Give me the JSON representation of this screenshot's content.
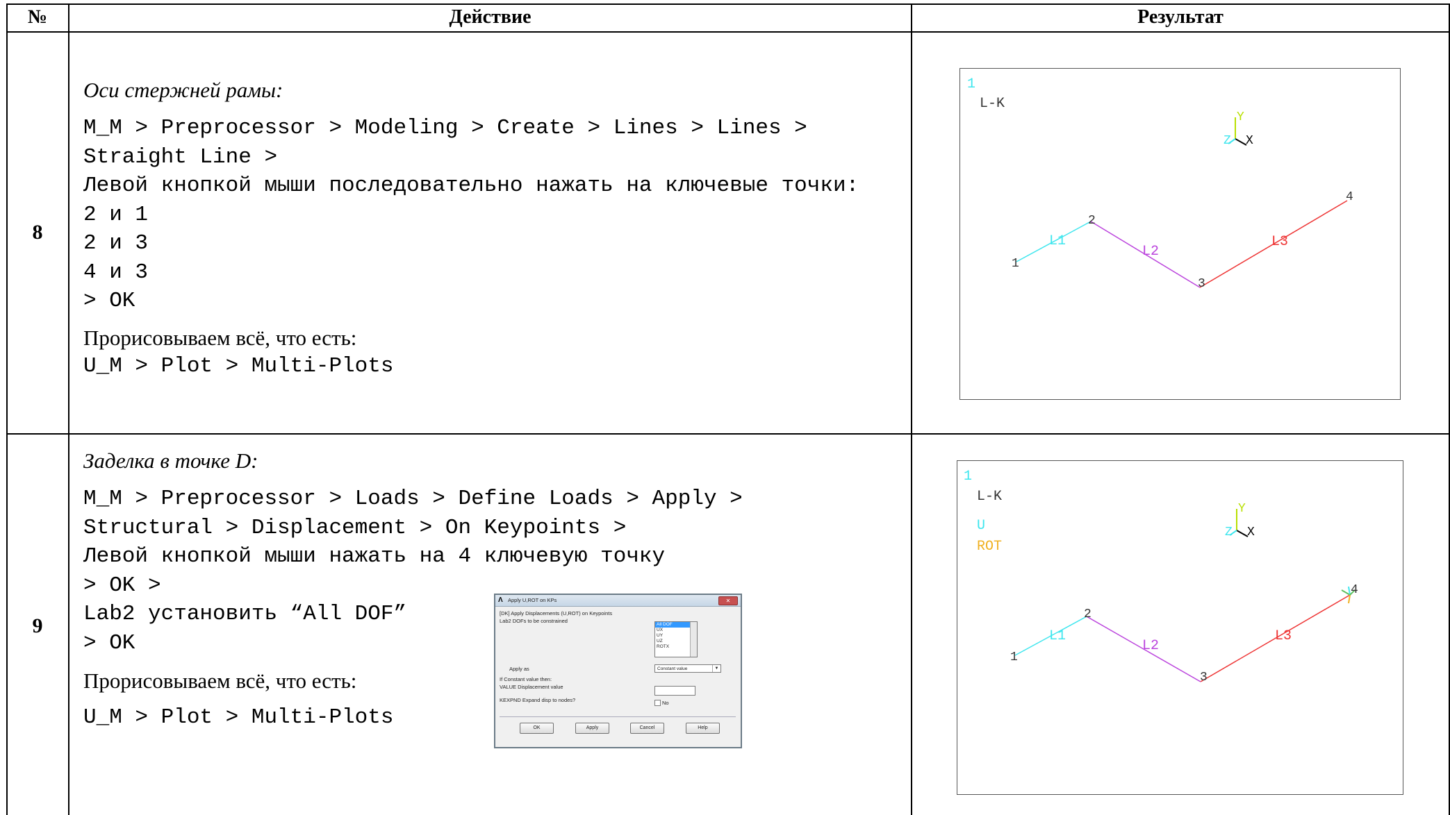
{
  "header": {
    "num": "№",
    "action": "Действие",
    "result": "Результат"
  },
  "rows": [
    {
      "num": "8",
      "heading": "Оси стержней рамы:",
      "code": [
        "M_M > Preprocessor > Modeling > Create > Lines > Lines >",
        "Straight Line >",
        "Левой кнопкой мыши последовательно нажать на ключевые точки:",
        "2 и 1",
        "2 и 3",
        "4 и 3",
        "> OK"
      ],
      "note": "Прорисовываем всё, что есть:",
      "code2": "U_M > Plot > Multi-Plots",
      "plot": {
        "window_num": "1",
        "label": "L-K",
        "axis_y": "Y",
        "axis_z": "Z",
        "axis_x": "X",
        "kp": [
          "1",
          "2",
          "3",
          "4"
        ],
        "lines": [
          "L1",
          "L2",
          "L3"
        ]
      }
    },
    {
      "num": "9",
      "heading": "Заделка в точке D:",
      "code": [
        "M_M > Preprocessor > Loads > Define Loads > Apply >",
        "Structural > Displacement > On Keypoints >",
        "Левой кнопкой мыши нажать на 4 ключевую точку",
        "> OK >",
        "Lab2 установить “All DOF”",
        "> OK"
      ],
      "note": "Прорисовываем всё, что есть:",
      "code2": "U_M > Plot > Multi-Plots",
      "plot": {
        "window_num": "1",
        "label": "L-K",
        "legend_u": "U",
        "legend_rot": "ROT",
        "axis_y": "Y",
        "axis_z": "Z",
        "axis_x": "X",
        "kp": [
          "1",
          "2",
          "3",
          "4"
        ],
        "lines": [
          "L1",
          "L2",
          "L3"
        ]
      },
      "dialog": {
        "title": "Apply U,ROT on KPs",
        "subtitle": "[DK]  Apply Displacements (U,ROT) on Keypoints",
        "lab2_label": "Lab2   DOFs to be constrained",
        "list_items": [
          "All DOF",
          "UX",
          "UY",
          "UZ",
          "ROTX"
        ],
        "apply_as_label": "Apply as",
        "apply_as_value": "Constant value",
        "if_const": "If Constant value then:",
        "value_label": "VALUE  Displacement value",
        "kexpnd_label": "KEXPND  Expand disp to nodes?",
        "kexpnd_value": "No",
        "buttons": [
          "OK",
          "Apply",
          "Cancel",
          "Help"
        ]
      }
    }
  ],
  "colors": {
    "cyan": "#3ee6ee",
    "purple": "#bb44dd",
    "red": "#ee3333",
    "y_axis": "#b8e000",
    "orange": "#f0b020",
    "constraint": "#60c060"
  }
}
